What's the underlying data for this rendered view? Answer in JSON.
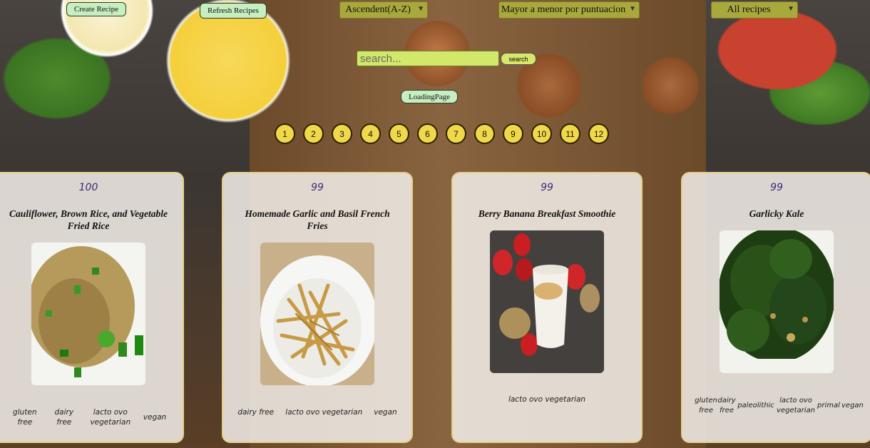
{
  "toolbar": {
    "create_recipe": "Create Recipe",
    "refresh_recipes": "Refresh Recipes",
    "sort_alpha": "Ascendent(A-Z)",
    "sort_score": "Mayor a menor por puntuacion",
    "diet_filter": "All recipes",
    "search_placeholder": "search...",
    "search_button": "search",
    "loading_page": "LoadingPage"
  },
  "pagination": [
    "1",
    "2",
    "3",
    "4",
    "5",
    "6",
    "7",
    "8",
    "9",
    "10",
    "11",
    "12"
  ],
  "recipes": [
    {
      "score": "100",
      "title": "Cauliflower, Brown Rice, and Vegetable Fried Rice",
      "diets": [
        "gluten free",
        "dairy free",
        "lacto ovo vegetarian",
        "vegan"
      ]
    },
    {
      "score": "99",
      "title": "Homemade Garlic and Basil French Fries",
      "diets": [
        "dairy free",
        "lacto ovo vegetarian",
        "vegan"
      ]
    },
    {
      "score": "99",
      "title": "Berry Banana Breakfast Smoothie",
      "diets": [
        "lacto ovo vegetarian"
      ]
    },
    {
      "score": "99",
      "title": "Garlicky Kale",
      "diets": [
        "gluten free",
        "dairy free",
        "paleolithic",
        "lacto ovo vegetarian",
        "primal",
        "vegan"
      ]
    }
  ]
}
